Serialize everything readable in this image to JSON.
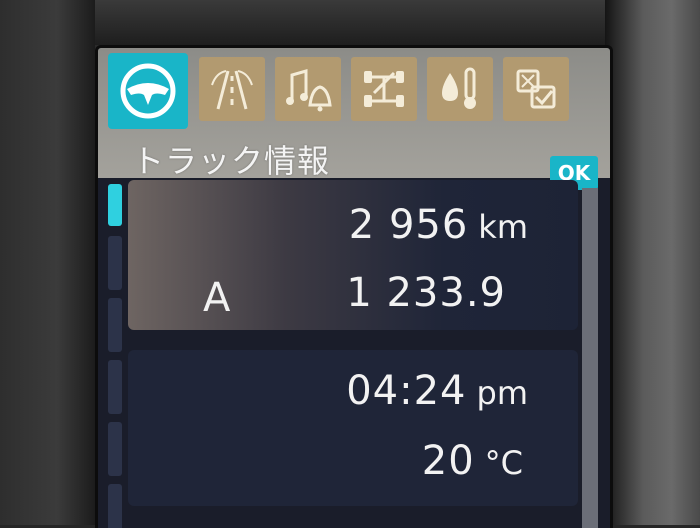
{
  "header": {
    "title": "トラック情報",
    "ok_label": "OK"
  },
  "tabs": [
    {
      "icon": "steering-wheel-icon",
      "active": true
    },
    {
      "icon": "road-icon",
      "active": false
    },
    {
      "icon": "music-bell-icon",
      "active": false
    },
    {
      "icon": "truck-axle-icon",
      "active": false
    },
    {
      "icon": "fluid-temperature-icon",
      "active": false
    },
    {
      "icon": "settings-check-icon",
      "active": false
    }
  ],
  "info": {
    "odometer": {
      "value": "2 956",
      "unit": "km"
    },
    "trip": {
      "label": "A",
      "value": "1 233.9"
    },
    "clock": {
      "value": "04:24",
      "unit": "pm"
    },
    "temperature": {
      "value": "20",
      "unit": "°C"
    }
  },
  "colors": {
    "accent": "#19b5c8",
    "tab_inactive": "#b29a70",
    "panel": "#1f2538",
    "text": "#f2f2f2"
  }
}
